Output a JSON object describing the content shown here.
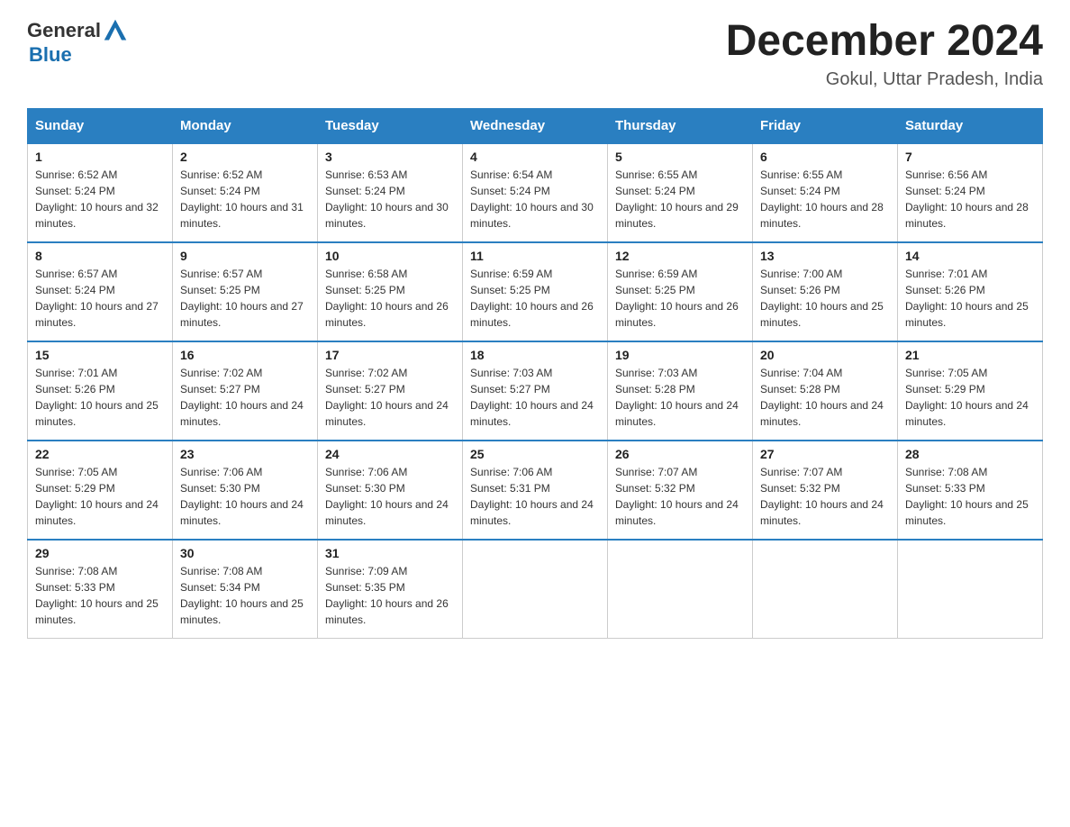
{
  "logo": {
    "text_general": "General",
    "text_blue": "Blue"
  },
  "header": {
    "title": "December 2024",
    "subtitle": "Gokul, Uttar Pradesh, India"
  },
  "days_of_week": [
    "Sunday",
    "Monday",
    "Tuesday",
    "Wednesday",
    "Thursday",
    "Friday",
    "Saturday"
  ],
  "weeks": [
    [
      {
        "day": "1",
        "sunrise": "6:52 AM",
        "sunset": "5:24 PM",
        "daylight": "10 hours and 32 minutes."
      },
      {
        "day": "2",
        "sunrise": "6:52 AM",
        "sunset": "5:24 PM",
        "daylight": "10 hours and 31 minutes."
      },
      {
        "day": "3",
        "sunrise": "6:53 AM",
        "sunset": "5:24 PM",
        "daylight": "10 hours and 30 minutes."
      },
      {
        "day": "4",
        "sunrise": "6:54 AM",
        "sunset": "5:24 PM",
        "daylight": "10 hours and 30 minutes."
      },
      {
        "day": "5",
        "sunrise": "6:55 AM",
        "sunset": "5:24 PM",
        "daylight": "10 hours and 29 minutes."
      },
      {
        "day": "6",
        "sunrise": "6:55 AM",
        "sunset": "5:24 PM",
        "daylight": "10 hours and 28 minutes."
      },
      {
        "day": "7",
        "sunrise": "6:56 AM",
        "sunset": "5:24 PM",
        "daylight": "10 hours and 28 minutes."
      }
    ],
    [
      {
        "day": "8",
        "sunrise": "6:57 AM",
        "sunset": "5:24 PM",
        "daylight": "10 hours and 27 minutes."
      },
      {
        "day": "9",
        "sunrise": "6:57 AM",
        "sunset": "5:25 PM",
        "daylight": "10 hours and 27 minutes."
      },
      {
        "day": "10",
        "sunrise": "6:58 AM",
        "sunset": "5:25 PM",
        "daylight": "10 hours and 26 minutes."
      },
      {
        "day": "11",
        "sunrise": "6:59 AM",
        "sunset": "5:25 PM",
        "daylight": "10 hours and 26 minutes."
      },
      {
        "day": "12",
        "sunrise": "6:59 AM",
        "sunset": "5:25 PM",
        "daylight": "10 hours and 26 minutes."
      },
      {
        "day": "13",
        "sunrise": "7:00 AM",
        "sunset": "5:26 PM",
        "daylight": "10 hours and 25 minutes."
      },
      {
        "day": "14",
        "sunrise": "7:01 AM",
        "sunset": "5:26 PM",
        "daylight": "10 hours and 25 minutes."
      }
    ],
    [
      {
        "day": "15",
        "sunrise": "7:01 AM",
        "sunset": "5:26 PM",
        "daylight": "10 hours and 25 minutes."
      },
      {
        "day": "16",
        "sunrise": "7:02 AM",
        "sunset": "5:27 PM",
        "daylight": "10 hours and 24 minutes."
      },
      {
        "day": "17",
        "sunrise": "7:02 AM",
        "sunset": "5:27 PM",
        "daylight": "10 hours and 24 minutes."
      },
      {
        "day": "18",
        "sunrise": "7:03 AM",
        "sunset": "5:27 PM",
        "daylight": "10 hours and 24 minutes."
      },
      {
        "day": "19",
        "sunrise": "7:03 AM",
        "sunset": "5:28 PM",
        "daylight": "10 hours and 24 minutes."
      },
      {
        "day": "20",
        "sunrise": "7:04 AM",
        "sunset": "5:28 PM",
        "daylight": "10 hours and 24 minutes."
      },
      {
        "day": "21",
        "sunrise": "7:05 AM",
        "sunset": "5:29 PM",
        "daylight": "10 hours and 24 minutes."
      }
    ],
    [
      {
        "day": "22",
        "sunrise": "7:05 AM",
        "sunset": "5:29 PM",
        "daylight": "10 hours and 24 minutes."
      },
      {
        "day": "23",
        "sunrise": "7:06 AM",
        "sunset": "5:30 PM",
        "daylight": "10 hours and 24 minutes."
      },
      {
        "day": "24",
        "sunrise": "7:06 AM",
        "sunset": "5:30 PM",
        "daylight": "10 hours and 24 minutes."
      },
      {
        "day": "25",
        "sunrise": "7:06 AM",
        "sunset": "5:31 PM",
        "daylight": "10 hours and 24 minutes."
      },
      {
        "day": "26",
        "sunrise": "7:07 AM",
        "sunset": "5:32 PM",
        "daylight": "10 hours and 24 minutes."
      },
      {
        "day": "27",
        "sunrise": "7:07 AM",
        "sunset": "5:32 PM",
        "daylight": "10 hours and 24 minutes."
      },
      {
        "day": "28",
        "sunrise": "7:08 AM",
        "sunset": "5:33 PM",
        "daylight": "10 hours and 25 minutes."
      }
    ],
    [
      {
        "day": "29",
        "sunrise": "7:08 AM",
        "sunset": "5:33 PM",
        "daylight": "10 hours and 25 minutes."
      },
      {
        "day": "30",
        "sunrise": "7:08 AM",
        "sunset": "5:34 PM",
        "daylight": "10 hours and 25 minutes."
      },
      {
        "day": "31",
        "sunrise": "7:09 AM",
        "sunset": "5:35 PM",
        "daylight": "10 hours and 26 minutes."
      },
      null,
      null,
      null,
      null
    ]
  ],
  "labels": {
    "sunrise_prefix": "Sunrise: ",
    "sunset_prefix": "Sunset: ",
    "daylight_prefix": "Daylight: "
  }
}
